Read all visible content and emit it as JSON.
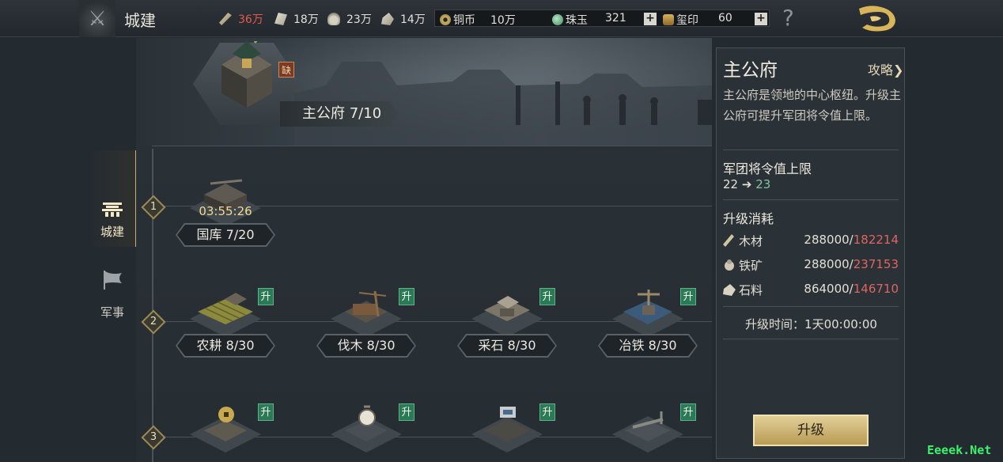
{
  "header": {
    "page_name": "城建",
    "resources": [
      {
        "name": "wood",
        "value": "36万"
      },
      {
        "name": "paper",
        "value": "18万"
      },
      {
        "name": "iron",
        "value": "23万"
      },
      {
        "name": "stone",
        "value": "14万"
      }
    ],
    "currencies": {
      "coin_label": "铜币",
      "coin_value": "10万",
      "jade_label": "珠玉",
      "jade_value": "321",
      "seal_label": "玺印",
      "seal_value": "60"
    },
    "help": "?"
  },
  "nav": {
    "build": "城建",
    "military": "军事"
  },
  "main_hall": {
    "name": "主公府 7/10",
    "missing_badge": "缺"
  },
  "tiers": [
    "1",
    "2",
    "3"
  ],
  "tier1": {
    "treasury": {
      "name": "国库 7/20",
      "timer": "03:55:26"
    }
  },
  "tier2": [
    {
      "name": "农耕 8/30",
      "badge": "升"
    },
    {
      "name": "伐木 8/30",
      "badge": "升"
    },
    {
      "name": "采石 8/30",
      "badge": "升"
    },
    {
      "name": "冶铁 8/30",
      "badge": "升"
    }
  ],
  "tier3": [
    {
      "badge": "升"
    },
    {
      "badge": "升"
    },
    {
      "badge": "升"
    },
    {
      "badge": "升"
    }
  ],
  "panel": {
    "title": "主公府",
    "guide": "攻略❯",
    "description": "主公府是领地的中心枢纽。升级主公府可提升军团将令值上限。",
    "stat_heading": "军团将令值上限",
    "stat_from": "22",
    "stat_arrow": "➔",
    "stat_to": "23",
    "cost_heading": "升级消耗",
    "costs": [
      {
        "name": "木材",
        "need": "288000/",
        "have": "182214"
      },
      {
        "name": "铁矿",
        "need": "288000/",
        "have": "237153"
      },
      {
        "name": "石料",
        "need": "864000/",
        "have": "146710"
      }
    ],
    "time": "升级时间：1天00:00:00",
    "upgrade_button": "升级"
  },
  "watermark": "Eeeek.Net",
  "colors": {
    "accent_gold": "#c9b06a",
    "shortage_red": "#e06460",
    "gain_green": "#7ec6a0",
    "upgrade_badge": "#2a7a56"
  }
}
